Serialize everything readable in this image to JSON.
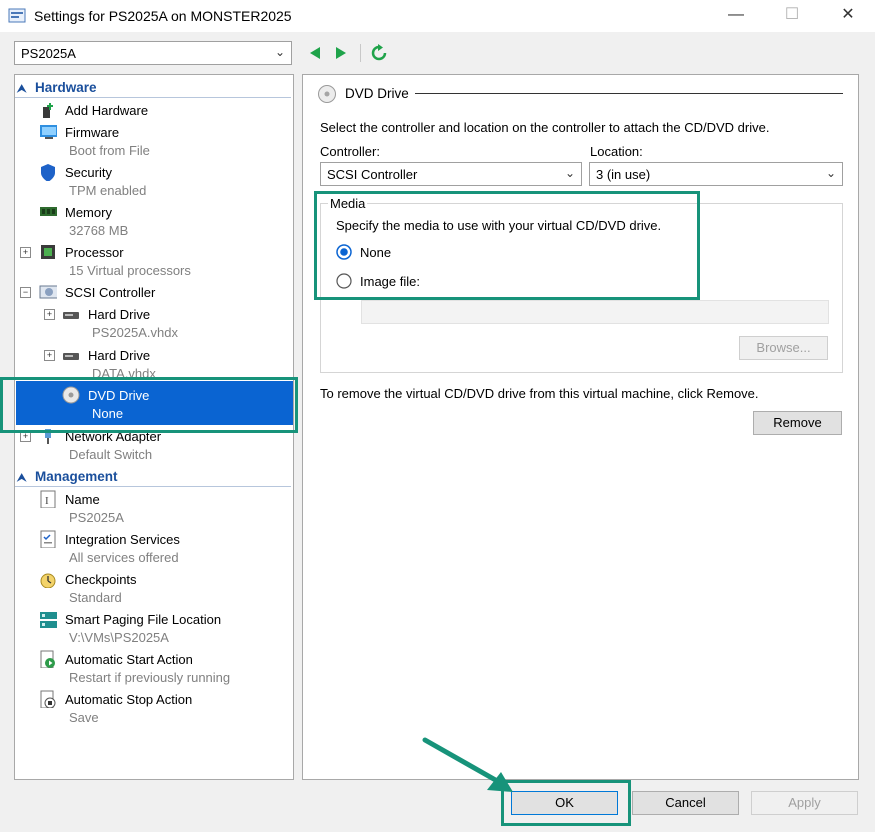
{
  "window": {
    "title": "Settings for PS2025A on MONSTER2025",
    "minimize": "—",
    "maximize": "☐",
    "close": "✕"
  },
  "vm_selector": {
    "value": "PS2025A"
  },
  "tree": {
    "hardware_header": "Hardware",
    "management_header": "Management",
    "items": [
      {
        "label": "Add Hardware",
        "sub": ""
      },
      {
        "label": "Firmware",
        "sub": "Boot from File"
      },
      {
        "label": "Security",
        "sub": "TPM enabled"
      },
      {
        "label": "Memory",
        "sub": "32768 MB"
      },
      {
        "label": "Processor",
        "sub": "15 Virtual processors"
      },
      {
        "label": "SCSI Controller",
        "sub": ""
      },
      {
        "label": "Hard Drive",
        "sub": "PS2025A.vhdx"
      },
      {
        "label": "Hard Drive",
        "sub": "DATA.vhdx"
      },
      {
        "label": "DVD Drive",
        "sub": "None"
      },
      {
        "label": "Network Adapter",
        "sub": "Default Switch"
      }
    ],
    "mgmt_items": [
      {
        "label": "Name",
        "sub": "PS2025A"
      },
      {
        "label": "Integration Services",
        "sub": "All services offered"
      },
      {
        "label": "Checkpoints",
        "sub": "Standard"
      },
      {
        "label": "Smart Paging File Location",
        "sub": "V:\\VMs\\PS2025A"
      },
      {
        "label": "Automatic Start Action",
        "sub": "Restart if previously running"
      },
      {
        "label": "Automatic Stop Action",
        "sub": "Save"
      }
    ]
  },
  "panel": {
    "heading": "DVD Drive",
    "instruction": "Select the controller and location on the controller to attach the CD/DVD drive.",
    "controller_label": "Controller:",
    "controller_value": "SCSI Controller",
    "location_label": "Location:",
    "location_value": "3 (in use)",
    "media_legend": "Media",
    "media_instruction": "Specify the media to use with your virtual CD/DVD drive.",
    "none_label": "None",
    "image_label": "Image file:",
    "browse_label": "Browse...",
    "remove_text": "To remove the virtual CD/DVD drive from this virtual machine, click Remove.",
    "remove_label": "Remove"
  },
  "footer": {
    "ok": "OK",
    "cancel": "Cancel",
    "apply": "Apply"
  },
  "colors": {
    "accent": "#0a64d2",
    "highlight": "#17937a",
    "header": "#1a4f9c"
  }
}
